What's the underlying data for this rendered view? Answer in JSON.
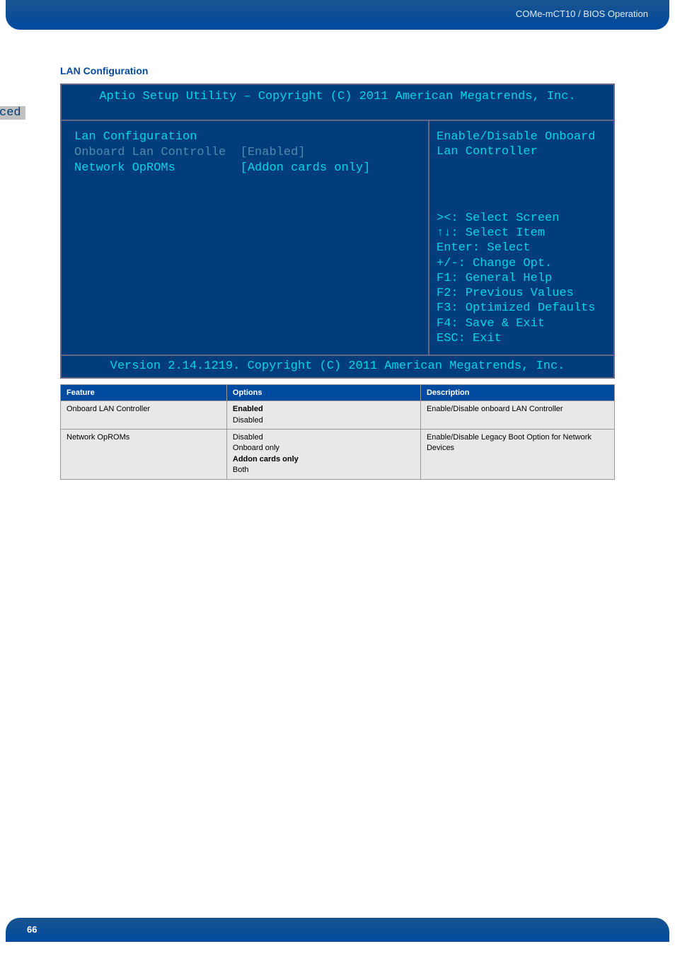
{
  "header": {
    "breadcrumb": "COMe-mCT10 / BIOS Operation"
  },
  "section": {
    "title": "LAN Configuration"
  },
  "bios": {
    "header": "Aptio Setup Utility – Copyright (C) 2011 American Megatrends, Inc.",
    "tab": "Advanced",
    "left": {
      "title": "Lan Configuration",
      "row1_label": "Onboard Lan Controlle",
      "row1_value": "[Enabled]",
      "row2_label": "Network OpROMs",
      "row2_value": "[Addon cards only]"
    },
    "right_top": "Enable/Disable Onboard\nLan Controller",
    "right_bottom": "><: Select Screen\n↑↓: Select Item\nEnter: Select\n+/-: Change Opt.\nF1: General Help\nF2: Previous Values\nF3: Optimized Defaults\nF4: Save & Exit\nESC: Exit",
    "footer": "Version 2.14.1219. Copyright (C) 2011 American Megatrends, Inc."
  },
  "table": {
    "headers": {
      "feature": "Feature",
      "options": "Options",
      "description": "Description"
    },
    "rows": [
      {
        "feature": "Onboard LAN Controller",
        "options_bold": "Enabled",
        "options_rest": "Disabled",
        "description": "Enable/Disable onboard LAN Controller"
      },
      {
        "feature": "Network OpROMs",
        "options_pre": "Disabled\nOnboard only",
        "options_bold": "Addon cards only",
        "options_rest": "Both",
        "description": "Enable/Disable Legacy Boot Option for Network Devices"
      }
    ]
  },
  "footer": {
    "page": "66"
  }
}
